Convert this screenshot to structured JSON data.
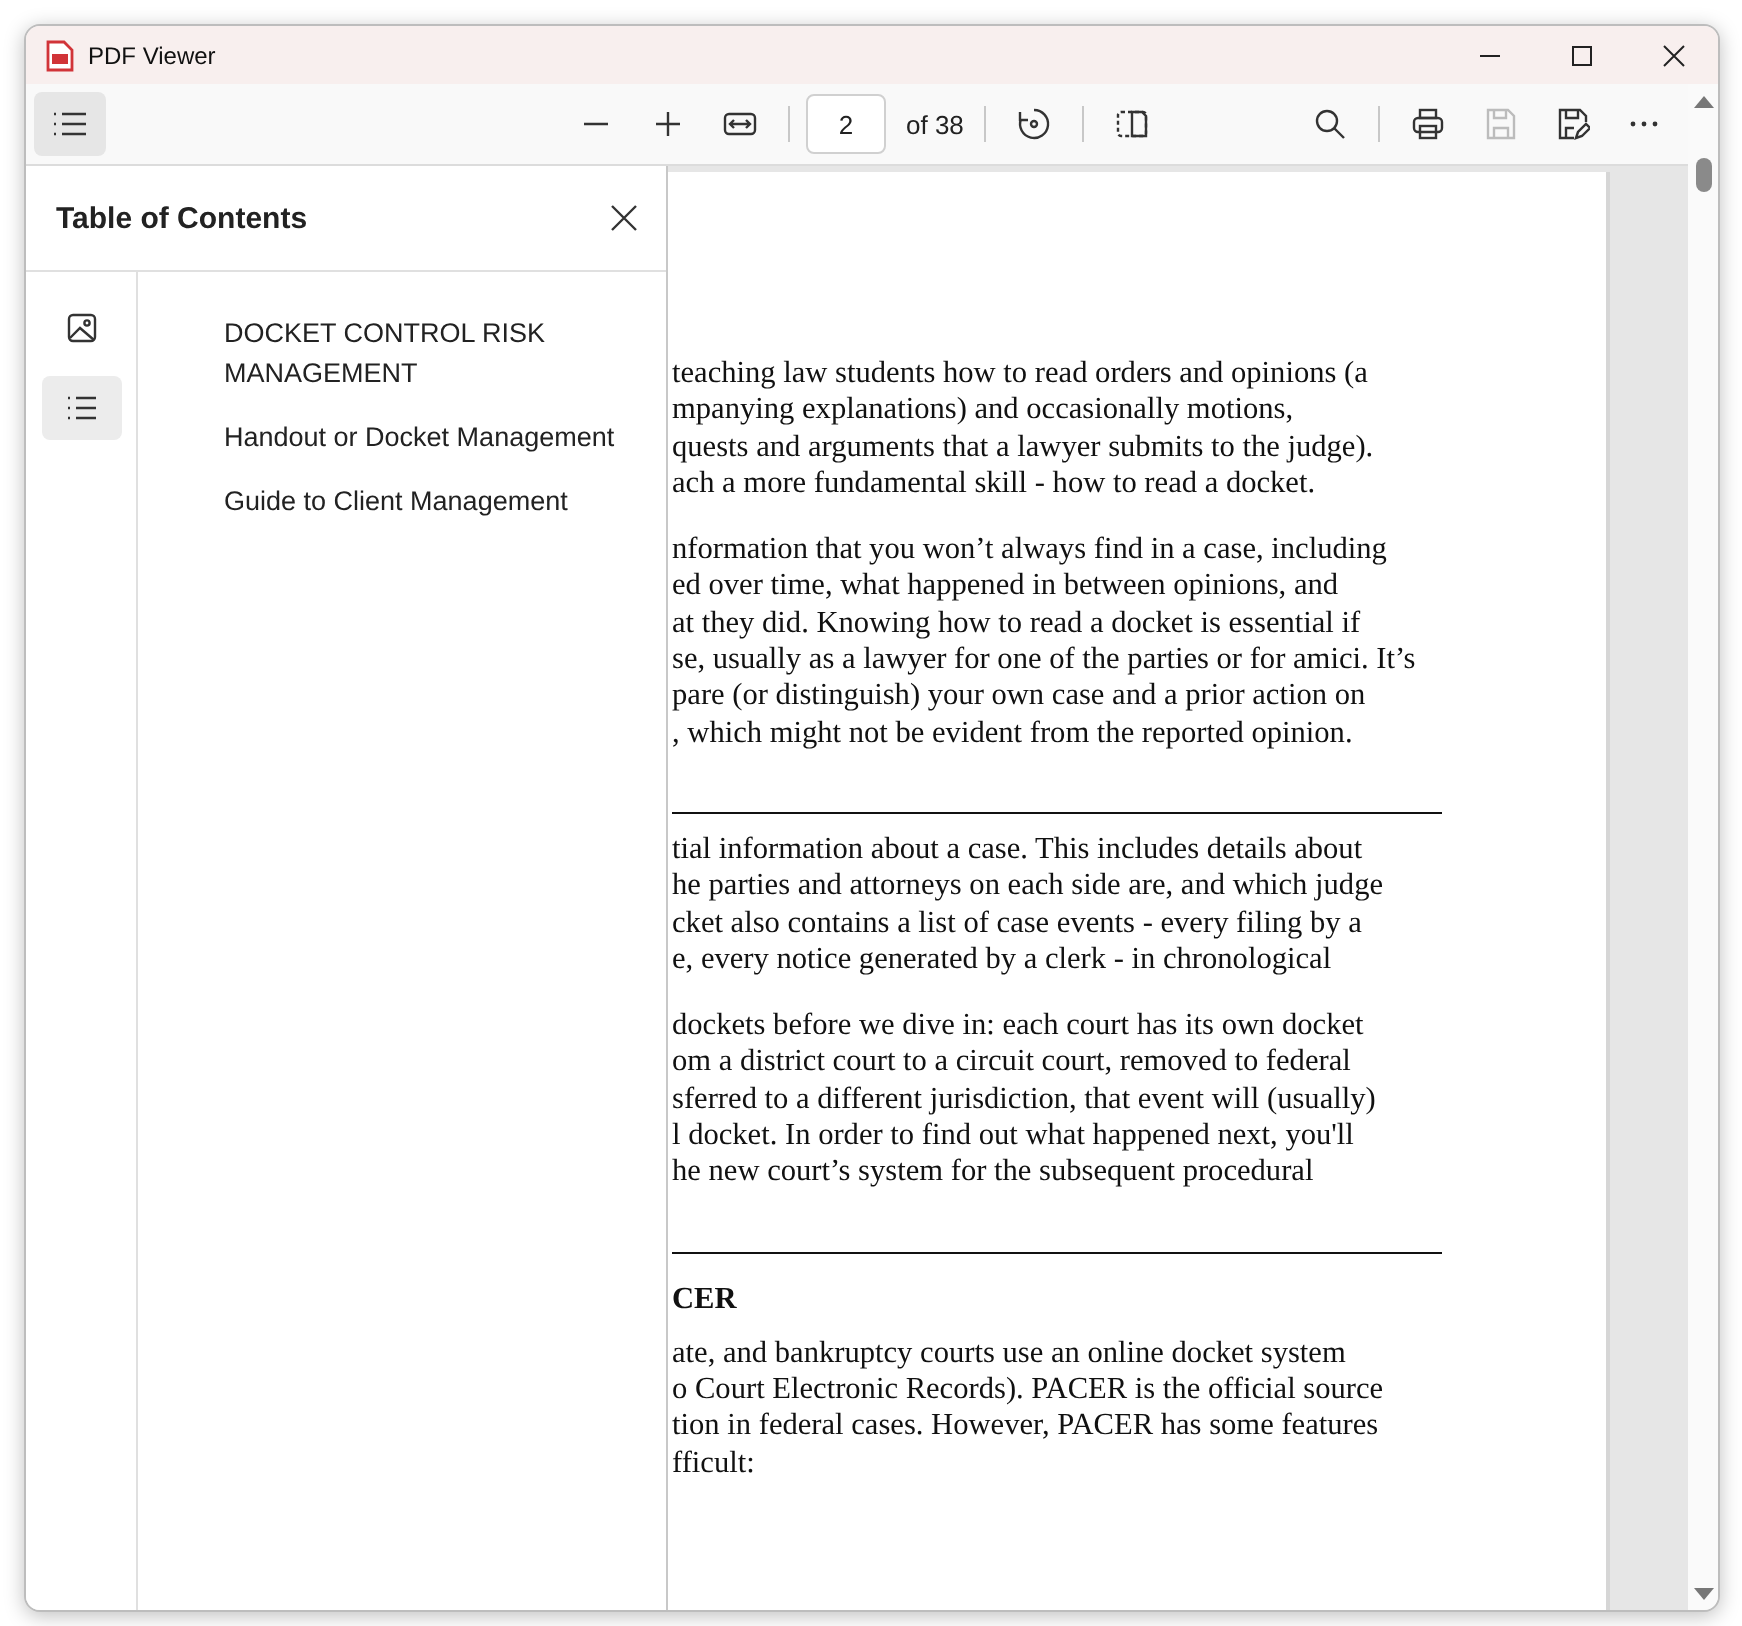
{
  "window": {
    "title": "PDF Viewer"
  },
  "toolbar": {
    "panel_toggle_selected": true,
    "groups": [
      [
        {
          "kind": "zoom-out",
          "disabled": false
        },
        {
          "kind": "zoom-in",
          "disabled": false
        },
        {
          "kind": "fit-width",
          "disabled": false
        }
      ],
      [
        {
          "kind": "page"
        }
      ],
      [
        {
          "kind": "rotate",
          "disabled": false
        }
      ],
      [
        {
          "kind": "two-page",
          "disabled": false
        }
      ]
    ],
    "page_input": "2",
    "page_total": "of 38",
    "right_groups": [
      [
        {
          "kind": "search",
          "disabled": false
        }
      ],
      [
        {
          "kind": "print",
          "disabled": false
        },
        {
          "kind": "save",
          "disabled": true
        },
        {
          "kind": "save-as",
          "disabled": false
        },
        {
          "kind": "more",
          "disabled": false
        }
      ]
    ]
  },
  "toc": {
    "title": "Table of Contents",
    "rail": [
      {
        "kind": "thumbnails",
        "selected": false
      },
      {
        "kind": "outline",
        "selected": true
      }
    ],
    "items": [
      {
        "label": "DOCKET CONTROL RISK MANAGEMENT"
      },
      {
        "label": "Handout or Docket Management"
      },
      {
        "label": "Guide to Client Management"
      }
    ]
  },
  "document": {
    "blocks": [
      {
        "kind": "paragraph",
        "lines": [
          "teaching law students how to read orders and opinions (a",
          "mpanying explanations) and occasionally motions,",
          "quests and arguments that a lawyer submits to the judge).",
          "ach a more fundamental skill - how to read a docket."
        ]
      },
      {
        "kind": "paragraph",
        "lines": [
          "nformation that you won’t always find in a case, including",
          "ed over time, what happened in between opinions, and",
          "at they did. Knowing how to read a docket is essential if",
          "se, usually as a lawyer for one of the parties or for amici. It’s",
          "pare (or distinguish) your own case and a prior action on",
          ", which might not be evident from the reported opinion."
        ]
      },
      {
        "kind": "rule"
      },
      {
        "kind": "paragraph",
        "lines": [
          "tial information about a case. This includes details about",
          "he parties and attorneys on each side are, and which judge",
          "cket also contains a list of case events - every filing by a",
          "e, every notice generated by a clerk - in chronological"
        ]
      },
      {
        "kind": "paragraph",
        "lines": [
          "dockets before we dive in: each court has its own docket",
          "om a district court to a circuit court, removed to federal",
          "sferred to a different jurisdiction, that event will (usually)",
          "l docket. In order to find out what happened next, you'll",
          "he new court’s system for the subsequent procedural"
        ]
      },
      {
        "kind": "rule"
      },
      {
        "kind": "heading",
        "text": "CER"
      },
      {
        "kind": "paragraph",
        "lines": [
          "ate, and bankruptcy courts use an online docket system",
          "o Court Electronic Records). PACER is the official source",
          "tion in federal cases. However, PACER has some features",
          "fficult:"
        ]
      }
    ]
  }
}
